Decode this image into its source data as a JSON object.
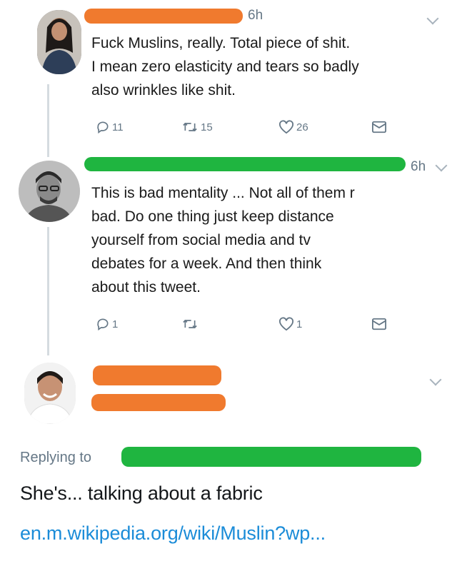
{
  "tweet1": {
    "time": "6h",
    "text": "Fuck Muslins, really. Total piece of shit.\nI mean zero elasticity and tears so badly\nalso wrinkles like shit.",
    "replies": "11",
    "retweets": "15",
    "likes": "26"
  },
  "tweet2": {
    "time": "6h",
    "text": "This is bad mentality ... Not all of them r\nbad. Do one thing just keep distance\nyourself from social media and tv\ndebates for a week. And then think\nabout this tweet.",
    "replies": "1",
    "retweets": "",
    "likes": "1"
  },
  "reply": {
    "replying_to_label": "Replying to",
    "text": "She's... talking about a fabric",
    "link": "en.m.wikipedia.org/wiki/Muslin?wp..."
  },
  "colors": {
    "orange_redaction": "#f07a2e",
    "green_redaction": "#1fb540",
    "link_blue": "#1b8cd8",
    "muted_gray": "#657786"
  },
  "icons": [
    "reply-icon",
    "retweet-icon",
    "like-icon",
    "message-icon",
    "chevron-down-icon"
  ]
}
